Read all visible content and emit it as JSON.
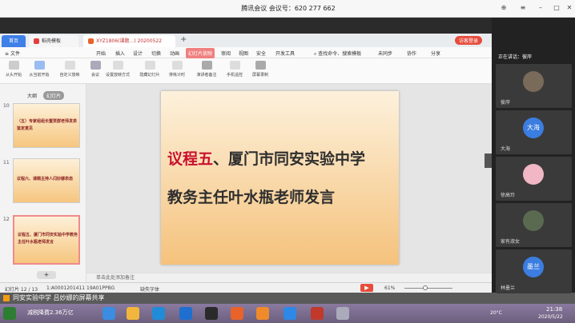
{
  "meeting": {
    "title": "腾讯会议 会议号：620 277 662"
  },
  "wps": {
    "tabs": {
      "home": "首页",
      "daoke": "稻壳模板",
      "doc": "XYZ1806(课题...) 20200522"
    },
    "login": "访客登录",
    "menu": [
      "文件",
      "开始",
      "插入",
      "设计",
      "切换",
      "动画",
      "幻灯片放映",
      "审阅",
      "视图",
      "安全",
      "开发工具"
    ],
    "active_menu": "幻灯片放映",
    "search": "查找命令、搜索模板",
    "right_menu": {
      "sync": "未同步",
      "collab": "协作",
      "share": "分享"
    },
    "tools": [
      "从头开始",
      "从当前开始",
      "自定义放映",
      "会议",
      "设置放映方式",
      "隐藏幻灯片",
      "排练计时",
      "演讲者备注",
      "手机遥控",
      "屏幕录制"
    ]
  },
  "left_panel": {
    "tabs": [
      "大纲",
      "幻灯片"
    ],
    "slides": [
      {
        "num": "10",
        "text": "（五）专家组组长暨贾群老师发表鉴定意见"
      },
      {
        "num": "11",
        "text": "议程六、课题主持人闫妙娜表态"
      },
      {
        "num": "12",
        "text": "议程五、厦门市同安实验中学教务主任叶水瓶老师发言"
      }
    ]
  },
  "slide": {
    "line1_red": "议程五",
    "line1_rest": "、厦门市同安实验中学",
    "line2": "教务主任叶水瓶老师发言"
  },
  "notes": "单击此处添加备注",
  "status": {
    "page": "幻灯片 12 / 13",
    "id": "1:A0001201411 19A01PPBG",
    "font": "缺失字体",
    "zoom": "61%"
  },
  "share_banner": "同安实验中学 吕妙娜的屏幕共享",
  "taskbar": {
    "tray": "减税降费2.36万亿",
    "time": "21:38",
    "date": "2020/5/22",
    "temp": "20°C"
  },
  "participants": {
    "speaking": "正在讲话：彼岸",
    "people": [
      {
        "name": "彼岸",
        "avatar": ""
      },
      {
        "name": "大海",
        "avatar": "大海"
      },
      {
        "name": "徐高玲",
        "avatar": ""
      },
      {
        "name": "家有淑女",
        "avatar": ""
      },
      {
        "name": "林墨兰",
        "avatar": "墨兰"
      }
    ]
  },
  "colors": {
    "accent": "#3f7fe8",
    "active_menu": "#f08080",
    "slide_red": "#c8102e"
  }
}
